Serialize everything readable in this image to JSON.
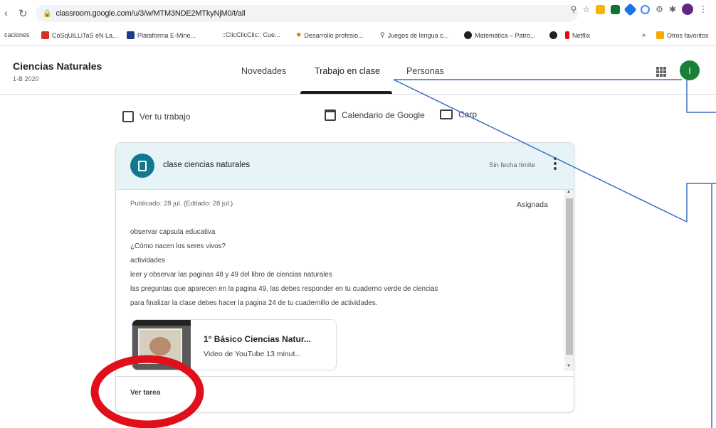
{
  "browser": {
    "url": "classroom.google.com/u/3/w/MTM3NDE2MTkyNjM0/t/all",
    "bookmarks": [
      "caciones",
      "CoSqUiLLiTaS eN La...",
      "Plataforma E-Mine...",
      "::ClicClicClic:: Cue...",
      "Desarrollo profesio...",
      "Juegos de lengua c...",
      "Matemática – Patro...",
      "Netflix",
      "Otros favoritos"
    ],
    "overflow": "»"
  },
  "header": {
    "class_name": "Ciencias Naturales",
    "class_section": "1-B 2020",
    "tabs": [
      "Novedades",
      "Trabajo en clase",
      "Personas"
    ],
    "avatar_letter": "I"
  },
  "toolbar": {
    "view_work": "Ver tu trabajo",
    "calendar": "Calendario de Google",
    "folder": "Carp"
  },
  "assignment": {
    "title": "clase ciencias naturales",
    "due": "Sin fecha límite",
    "posted": "Publicado: 28 jul. (Editado: 28 jul.)",
    "status": "Asignada",
    "description": [
      "observar capsula educativa",
      "¿Cómo nacen los seres vivos?",
      "actividades",
      "leer y observar las paginas 48 y 49 del libro de ciencias naturales",
      "las preguntas que aparecen en la pagina 49, las debes responder en tu cuaderno verde de ciencias",
      "para finalizar la clase debes hacer la pagina 24 de tu cuadernillo de actividades."
    ],
    "attachment": {
      "title": "1° Básico Ciencias Natur...",
      "subtitle": "Video de YouTube   13 minut..."
    },
    "view_task": "Ver tarea"
  },
  "colors": {
    "annotation_red": "#e0101a",
    "annotation_blue": "#3a6fc4",
    "card_header": "#e6f4f8",
    "assignment_icon": "#12788d",
    "avatar": "#188038"
  }
}
